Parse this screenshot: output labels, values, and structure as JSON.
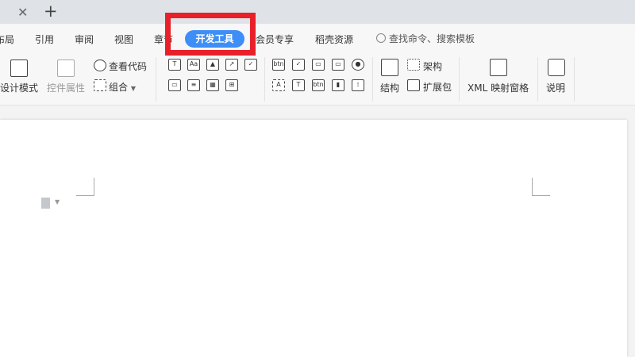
{
  "tabbar": {
    "close_icon": "close-icon",
    "new_icon": "plus-icon"
  },
  "menu": {
    "items": [
      "布局",
      "引用",
      "审阅",
      "视图",
      "章节",
      "开发工具",
      "会员专享",
      "稻壳资源"
    ],
    "active": "开发工具",
    "search_label": "查找命令、搜索模板"
  },
  "ribbon": {
    "design_mode": "设计模式",
    "control_props": "控件属性",
    "view_code": "查看代码",
    "combine": "组合",
    "structure": "结构",
    "schema": "架构",
    "expansion_pack": "扩展包",
    "xml_pane": "XML 映射窗格",
    "description": "说明"
  },
  "controls_row1": [
    "T",
    "Aa",
    "▲",
    "↗",
    "✓"
  ],
  "controls_row2": [
    "▭",
    "≡",
    "▦",
    "⊞"
  ],
  "legacy_row1": [
    "btn",
    "✓",
    "▭",
    "▭",
    "●"
  ],
  "legacy_row2": [
    "A",
    "T",
    "btn",
    "▮",
    "⁞"
  ],
  "colors": {
    "accent": "#3e8ef7",
    "highlight": "#e8202a"
  }
}
